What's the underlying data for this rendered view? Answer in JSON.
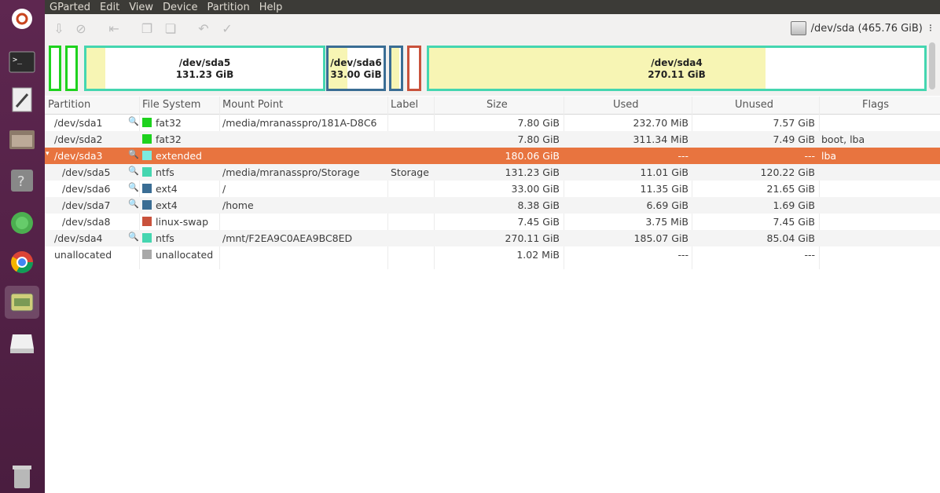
{
  "menubar": [
    "GParted",
    "Edit",
    "View",
    "Device",
    "Partition",
    "Help"
  ],
  "device": {
    "label": "/dev/sda  (465.76 GiB)"
  },
  "visual": [
    {
      "label": "/dev/sda5",
      "size": "131.23 GiB"
    },
    {
      "label": "/dev/sda6",
      "size": "33.00 GiB"
    },
    {
      "label": "/dev/sda4",
      "size": "270.11 GiB"
    }
  ],
  "headers": [
    "Partition",
    "File System",
    "Mount Point",
    "Label",
    "Size",
    "Used",
    "Unused",
    "Flags"
  ],
  "rows": [
    {
      "partition": "/dev/sda1",
      "fs": "fat32",
      "fs_color": "#1ed21e",
      "mount": "/media/mranasspro/181A-D8C6",
      "label": "",
      "size": "7.80 GiB",
      "used": "232.70 MiB",
      "unused": "7.57 GiB",
      "flags": ""
    },
    {
      "partition": "/dev/sda2",
      "fs": "fat32",
      "fs_color": "#1ed21e",
      "mount": "",
      "label": "",
      "size": "7.80 GiB",
      "used": "311.34 MiB",
      "unused": "7.49 GiB",
      "flags": "boot, lba"
    },
    {
      "partition": "/dev/sda3",
      "fs": "extended",
      "fs_color": "#7deae0",
      "mount": "",
      "label": "",
      "size": "180.06 GiB",
      "used": "---",
      "unused": "---",
      "flags": "lba"
    },
    {
      "partition": "/dev/sda5",
      "fs": "ntfs",
      "fs_color": "#45d6b0",
      "mount": "/media/mranasspro/Storage",
      "label": "Storage",
      "size": "131.23 GiB",
      "used": "11.01 GiB",
      "unused": "120.22 GiB",
      "flags": ""
    },
    {
      "partition": "/dev/sda6",
      "fs": "ext4",
      "fs_color": "#3a6d94",
      "mount": "/",
      "label": "",
      "size": "33.00 GiB",
      "used": "11.35 GiB",
      "unused": "21.65 GiB",
      "flags": ""
    },
    {
      "partition": "/dev/sda7",
      "fs": "ext4",
      "fs_color": "#3a6d94",
      "mount": "/home",
      "label": "",
      "size": "8.38 GiB",
      "used": "6.69 GiB",
      "unused": "1.69 GiB",
      "flags": ""
    },
    {
      "partition": "/dev/sda8",
      "fs": "linux-swap",
      "fs_color": "#c9523c",
      "mount": "",
      "label": "",
      "size": "7.45 GiB",
      "used": "3.75 MiB",
      "unused": "7.45 GiB",
      "flags": ""
    },
    {
      "partition": "/dev/sda4",
      "fs": "ntfs",
      "fs_color": "#45d6b0",
      "mount": "/mnt/F2EA9C0AEA9BC8ED",
      "label": "",
      "size": "270.11 GiB",
      "used": "185.07 GiB",
      "unused": "85.04 GiB",
      "flags": ""
    },
    {
      "partition": "unallocated",
      "fs": "unallocated",
      "fs_color": "#a8a8a8",
      "mount": "",
      "label": "",
      "size": "1.02 MiB",
      "used": "---",
      "unused": "---",
      "flags": ""
    }
  ]
}
